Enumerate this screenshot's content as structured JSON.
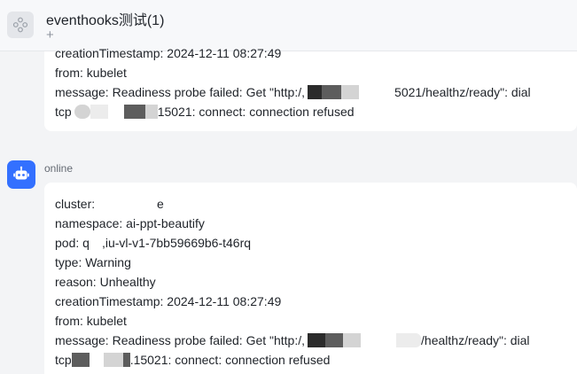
{
  "header": {
    "title": "eventhooks测试(1)",
    "add_symbol": "+",
    "avatar_icon": "group-avatar-icon"
  },
  "message1": {
    "line_partial": "creationTimestamp: 2024-12-11 08:27:49",
    "from": "from: kubelet",
    "msg_start": "message: Readiness probe failed: Get \"http:/,",
    "msg_end": "5021/healthz/ready\": dial",
    "tcp_start": "tcp",
    "tcp_end": "15021: connect: connection refused"
  },
  "sender": {
    "name": "online",
    "avatar_icon": "robot-icon",
    "avatar_color": "#3370ff"
  },
  "message2": {
    "cluster_start": "cluster: ",
    "cluster_end": "e",
    "namespace": "namespace: ai-ppt-beautify",
    "pod_start": "pod: q",
    "pod_end": ",iu-vl-v1-7bb59669b6-t46rq",
    "type": "type: Warning",
    "reason": "reason: Unhealthy",
    "timestamp": "creationTimestamp: 2024-12-11 08:27:49",
    "from": "from: kubelet",
    "msg_start": "message: Readiness probe failed: Get \"http:/,",
    "msg_end": "/healthz/ready\": dial",
    "tcp_start": "tcp",
    "tcp_end": ".15021: connect: connection refused"
  }
}
